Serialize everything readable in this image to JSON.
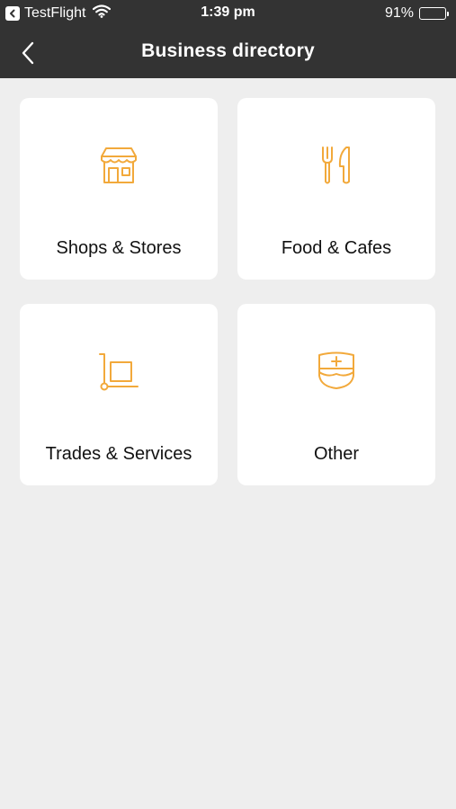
{
  "status_bar": {
    "carrier": "TestFlight",
    "time": "1:39 pm",
    "battery_percent": "91%",
    "battery_level": 0.91
  },
  "nav": {
    "title": "Business directory",
    "back_icon": "chevron-left-icon"
  },
  "theme": {
    "bar_color": "#333333",
    "background": "#eeeeee",
    "accent": "#f2a93b"
  },
  "categories": [
    {
      "label": "Shops & Stores",
      "icon": "storefront-icon"
    },
    {
      "label": "Food & Cafes",
      "icon": "fork-knife-icon"
    },
    {
      "label": "Trades & Services",
      "icon": "hand-truck-icon"
    },
    {
      "label": "Other",
      "icon": "nurse-cap-icon"
    }
  ]
}
